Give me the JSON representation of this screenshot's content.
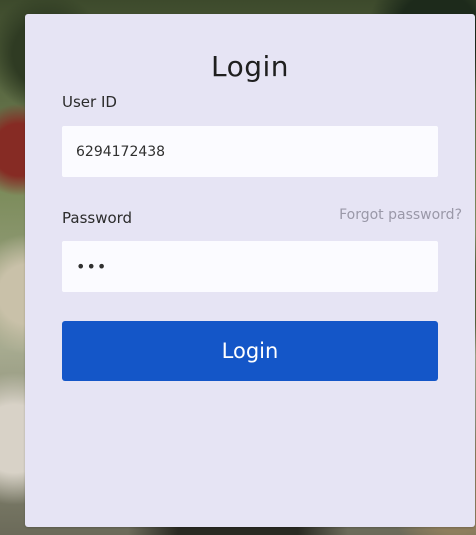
{
  "login": {
    "title": "Login",
    "user_id_label": "User ID",
    "user_id_value": "6294172438",
    "password_label": "Password",
    "password_masked": "•••",
    "forgot_password_label": "Forgot password?",
    "button_label": "Login"
  }
}
